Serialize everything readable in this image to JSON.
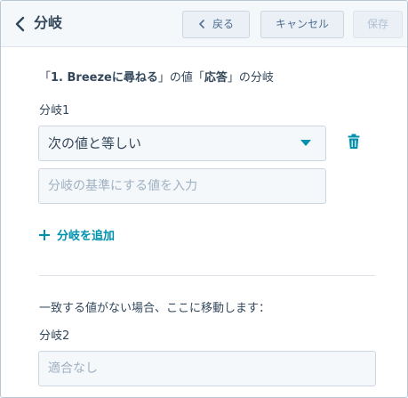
{
  "header": {
    "title": "分岐",
    "back_label": "戻る",
    "cancel_label": "キャンセル",
    "save_label": "保存"
  },
  "branch_config": {
    "description_prefix": "「",
    "action_name": "1. Breezeに尋ねる",
    "description_mid": "」の値「",
    "field_name": "応答",
    "description_suffix": "」の分岐"
  },
  "branch1": {
    "label": "分岐1",
    "operator_selected": "次の値と等しい",
    "value_placeholder": "分岐の基準にする値を入力",
    "value": ""
  },
  "add_branch_label": "分岐を追加",
  "fallback": {
    "text": "一致する値がない場合、ここに移動します：",
    "label": "分岐2",
    "placeholder": "適合なし"
  },
  "colors": {
    "accent": "#0091ae",
    "text": "#33475b",
    "header_bg": "#f5f8fa",
    "border": "#cbd6e2"
  },
  "icons": {
    "back": "chevron-left-icon",
    "dropdown": "caret-down-icon",
    "delete": "trash-icon",
    "add": "plus-icon"
  }
}
